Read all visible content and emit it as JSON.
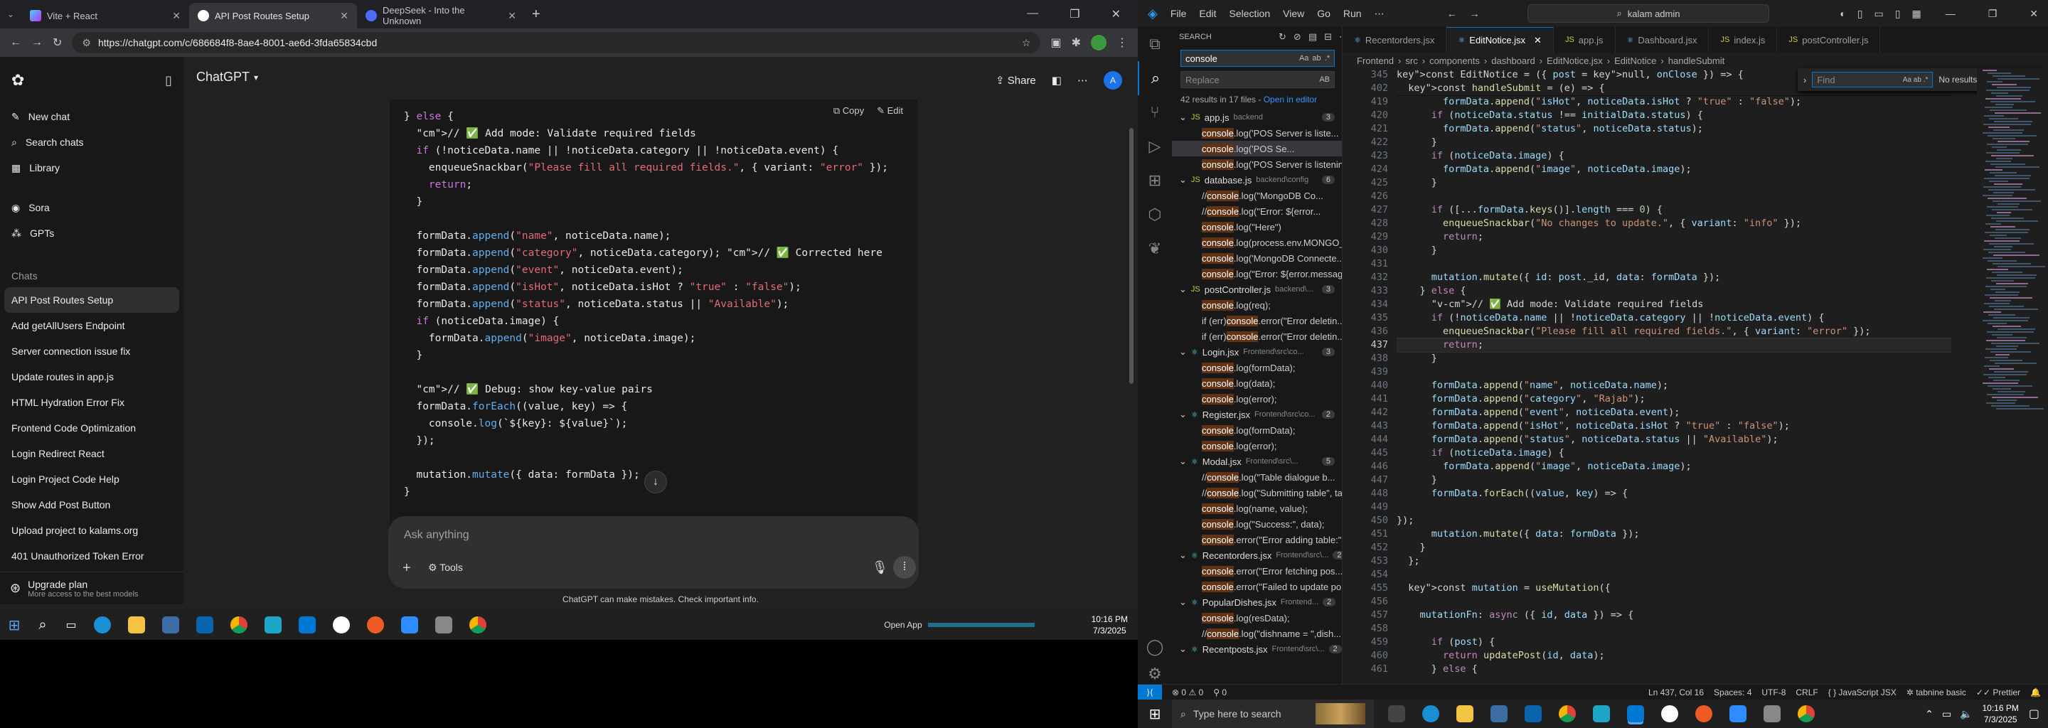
{
  "browser": {
    "tabs": [
      {
        "title": "Vite + React",
        "color": "#8b5cf6"
      },
      {
        "title": "API Post Routes Setup",
        "color": "#ffffff"
      },
      {
        "title": "DeepSeek - Into the Unknown",
        "color": "#4d6bfe"
      }
    ],
    "url": "https://chatgpt.com/c/686684f8-8ae4-8001-ae6d-3fda65834cbd"
  },
  "chatgpt": {
    "sidebar": {
      "new_chat": "New chat",
      "search_chats": "Search chats",
      "library": "Library",
      "sora": "Sora",
      "gpts": "GPTs",
      "chats_heading": "Chats",
      "chats": [
        "API Post Routes Setup",
        "Add getAllUsers Endpoint",
        "Server connection issue fix",
        "Update routes in app.js",
        "HTML Hydration Error Fix",
        "Frontend Code Optimization",
        "Login Redirect React",
        "Login Project Code Help",
        "Show Add Post Button",
        "Upload project to kalams.org",
        "401 Unauthorized Token Error"
      ],
      "upgrade_title": "Upgrade plan",
      "upgrade_sub": "More access to the best models"
    },
    "header": {
      "model": "ChatGPT",
      "share": "Share"
    },
    "code_actions": {
      "copy": "Copy",
      "edit": "Edit"
    },
    "code_lines": [
      "} else {",
      "  // ✅ Add mode: Validate required fields",
      "  if (!noticeData.name || !noticeData.category || !noticeData.event) {",
      "    enqueueSnackbar(\"Please fill all required fields.\", { variant: \"error\" });",
      "    return;",
      "  }",
      "",
      "  formData.append(\"name\", noticeData.name);",
      "  formData.append(\"category\", noticeData.category); // ✅ Corrected here",
      "  formData.append(\"event\", noticeData.event);",
      "  formData.append(\"isHot\", noticeData.isHot ? \"true\" : \"false\");",
      "  formData.append(\"status\", noticeData.status || \"Available\");",
      "  if (noticeData.image) {",
      "    formData.append(\"image\", noticeData.image);",
      "  }",
      "",
      "  // ✅ Debug: show key-value pairs",
      "  formData.forEach((value, key) => {",
      "    console.log(`${key}: ${value}`);",
      "  });",
      "",
      "  mutation.mutate({ data: formData });",
      "}"
    ],
    "input_placeholder": "Ask anything",
    "tools_label": "Tools",
    "disclaimer": "ChatGPT can make mistakes. Check important info."
  },
  "taskbar_left": {
    "time": "10:16 PM",
    "date": "7/3/2025",
    "open_app": "Open App"
  },
  "vscode": {
    "menu": [
      "File",
      "Edit",
      "Selection",
      "View",
      "Go",
      "Run"
    ],
    "search_box": "kalam admin",
    "panel_title": "SEARCH",
    "search_term": "console",
    "replace_placeholder": "Replace",
    "results_summary": "42 results in 17 files - ",
    "open_in_editor": "Open in editor",
    "results": [
      {
        "file": "app.js",
        "path": "backend",
        "count": "3",
        "lines": [
          "console.log('POS Server is liste...",
          "console.log('POS Se...",
          "console.log('POS Server is listenin..."
        ]
      },
      {
        "file": "database.js",
        "path": "backend\\config",
        "count": "6",
        "lines": [
          "//   console.log(\"MongoDB Co...",
          "//   console.log(\"Error: ${error...",
          "console.log(\"Here\")",
          "console.log(process.env.MONGO_...",
          "console.log('MongoDB Connecte...",
          "console.log(\"Error: ${error.messag..."
        ]
      },
      {
        "file": "postController.js",
        "path": "backend\\...",
        "count": "3",
        "lines": [
          "console.log(req);",
          "if (err) console.error(\"Error deletin...",
          "if (err) console.error(\"Error deletin..."
        ]
      },
      {
        "file": "Login.jsx",
        "path": "Frontend\\src\\co...",
        "count": "3",
        "lines": [
          "console.log(formData);",
          "console.log(data);",
          "console.log(error);"
        ]
      },
      {
        "file": "Register.jsx",
        "path": "Frontend\\src\\co...",
        "count": "2",
        "lines": [
          "console.log(formData);",
          "console.log(error);"
        ]
      },
      {
        "file": "Modal.jsx",
        "path": "Frontend\\src\\...",
        "count": "5",
        "lines": [
          "// console.log(\"Table dialogue b...",
          "// console.log(\"Submitting table\", ta...",
          "console.log(name, value);",
          "console.log(\"Success:\", data);",
          "console.error(\"Error adding table:\"..."
        ]
      },
      {
        "file": "Recentorders.jsx",
        "path": "Frontend\\src\\...",
        "count": "2",
        "lines": [
          "console.error(\"Error fetching pos...",
          "console.error(\"Failed to update po..."
        ]
      },
      {
        "file": "PopularDishes.jsx",
        "path": "Frontend...",
        "count": "2",
        "lines": [
          "console.log(resData);",
          "// console.log(\"dishname = \",dish..."
        ]
      },
      {
        "file": "Recentposts.jsx",
        "path": "Frontend\\src\\...",
        "count": "2",
        "lines": []
      }
    ],
    "editor_tabs": [
      "Recentorders.jsx",
      "EditNotice.jsx",
      "app.js",
      "Dashboard.jsx",
      "index.js",
      "postController.js"
    ],
    "breadcrumbs": [
      "Frontend",
      "src",
      "components",
      "dashboard",
      "EditNotice.jsx",
      "EditNotice",
      "handleSubmit"
    ],
    "find_placeholder": "Find",
    "find_result": "No results",
    "sticky_lines": [
      {
        "num": "345",
        "text": "const EditNotice = ({ post = null, onClose }) => {"
      },
      {
        "num": "402",
        "text": "  const handleSubmit = (e) => {"
      }
    ],
    "code_lines": [
      {
        "num": "419",
        "text": "        formData.append(\"isHot\", noticeData.isHot ? \"true\" : \"false\");"
      },
      {
        "num": "420",
        "text": "      if (noticeData.status !== initialData.status) {"
      },
      {
        "num": "421",
        "text": "        formData.append(\"status\", noticeData.status);"
      },
      {
        "num": "422",
        "text": "      }"
      },
      {
        "num": "423",
        "text": "      if (noticeData.image) {"
      },
      {
        "num": "424",
        "text": "        formData.append(\"image\", noticeData.image);"
      },
      {
        "num": "425",
        "text": "      }"
      },
      {
        "num": "426",
        "text": ""
      },
      {
        "num": "427",
        "text": "      if ([...formData.keys()].length === 0) {"
      },
      {
        "num": "428",
        "text": "        enqueueSnackbar(\"No changes to update.\", { variant: \"info\" });"
      },
      {
        "num": "429",
        "text": "        return;"
      },
      {
        "num": "430",
        "text": "      }"
      },
      {
        "num": "431",
        "text": ""
      },
      {
        "num": "432",
        "text": "      mutation.mutate({ id: post._id, data: formData });"
      },
      {
        "num": "433",
        "text": "    } else {"
      },
      {
        "num": "434",
        "text": "      // ✅ Add mode: Validate required fields"
      },
      {
        "num": "435",
        "text": "      if (!noticeData.name || !noticeData.category || !noticeData.event) {"
      },
      {
        "num": "436",
        "text": "        enqueueSnackbar(\"Please fill all required fields.\", { variant: \"error\" });"
      },
      {
        "num": "437",
        "text": "        return;"
      },
      {
        "num": "438",
        "text": "      }"
      },
      {
        "num": "439",
        "text": ""
      },
      {
        "num": "440",
        "text": "      formData.append(\"name\", noticeData.name);"
      },
      {
        "num": "441",
        "text": "      formData.append(\"category\", \"Rajab\");"
      },
      {
        "num": "442",
        "text": "      formData.append(\"event\", noticeData.event);"
      },
      {
        "num": "443",
        "text": "      formData.append(\"isHot\", noticeData.isHot ? \"true\" : \"false\");"
      },
      {
        "num": "444",
        "text": "      formData.append(\"status\", noticeData.status || \"Available\");"
      },
      {
        "num": "445",
        "text": "      if (noticeData.image) {"
      },
      {
        "num": "446",
        "text": "        formData.append(\"image\", noticeData.image);"
      },
      {
        "num": "447",
        "text": "      }"
      },
      {
        "num": "448",
        "text": "      formData.forEach((value, key) => {"
      },
      {
        "num": "449",
        "text": ""
      },
      {
        "num": "450",
        "text": "});"
      },
      {
        "num": "451",
        "text": "      mutation.mutate({ data: formData });"
      },
      {
        "num": "452",
        "text": "    }"
      },
      {
        "num": "453",
        "text": "  };"
      },
      {
        "num": "454",
        "text": ""
      },
      {
        "num": "455",
        "text": "  const mutation = useMutation({"
      },
      {
        "num": "456",
        "text": ""
      },
      {
        "num": "457",
        "text": "    mutationFn: async ({ id, data }) => {"
      },
      {
        "num": "458",
        "text": ""
      },
      {
        "num": "459",
        "text": "      if (post) {"
      },
      {
        "num": "460",
        "text": "        return updatePost(id, data);"
      },
      {
        "num": "461",
        "text": "      } else {"
      }
    ],
    "status": {
      "errors": "0",
      "warnings": "0",
      "position": "Ln 437, Col 16",
      "spaces": "Spaces: 4",
      "encoding": "UTF-8",
      "eol": "CRLF",
      "language": "JavaScript JSX",
      "tabnine": "tabnine basic",
      "prettier": "Prettier"
    }
  },
  "taskbar_right": {
    "search_placeholder": "Type here to search",
    "time": "10:16 PM",
    "date": "7/3/2025"
  }
}
